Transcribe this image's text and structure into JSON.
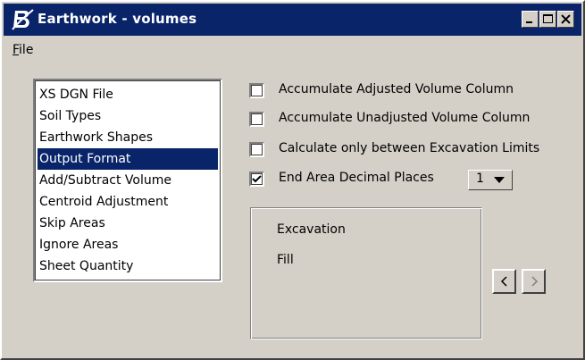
{
  "window": {
    "title": "Earthwork - volumes",
    "icon": "bentley-b-icon",
    "controls": [
      "minimize-icon",
      "maximize-icon",
      "close-icon"
    ]
  },
  "menu": {
    "items": [
      {
        "label": "File",
        "mnemonic": "F"
      }
    ]
  },
  "categories": {
    "selected_index": 3,
    "items": [
      {
        "label": "XS DGN File"
      },
      {
        "label": "Soil Types"
      },
      {
        "label": "Earthwork Shapes"
      },
      {
        "label": "Output Format"
      },
      {
        "label": "Add/Subtract Volume"
      },
      {
        "label": "Centroid Adjustment"
      },
      {
        "label": "Skip Areas"
      },
      {
        "label": "Ignore Areas"
      },
      {
        "label": "Sheet Quantity"
      }
    ]
  },
  "options": [
    {
      "label": "Accumulate Adjusted Volume Column",
      "checked": false
    },
    {
      "label": "Accumulate Unadjusted Volume Column",
      "checked": false
    },
    {
      "label": "Calculate only between Excavation Limits",
      "checked": false
    },
    {
      "label": "End Area Decimal Places",
      "checked": true
    }
  ],
  "decimal_places": {
    "value": "1",
    "arrow_icon": "dropdown-arrow-icon"
  },
  "columns_box": {
    "items": [
      {
        "label": "Excavation"
      },
      {
        "label": "Fill"
      }
    ]
  },
  "navigation": {
    "prev_icon": "chevron-left-icon",
    "next_icon": "chevron-right-icon",
    "next_enabled": false
  },
  "colors": {
    "face": "#d4d0c8",
    "title_bar": "#0a246a",
    "selection": "#0a246a",
    "selection_text": "#ffffff",
    "disabled_text": "#808080"
  }
}
